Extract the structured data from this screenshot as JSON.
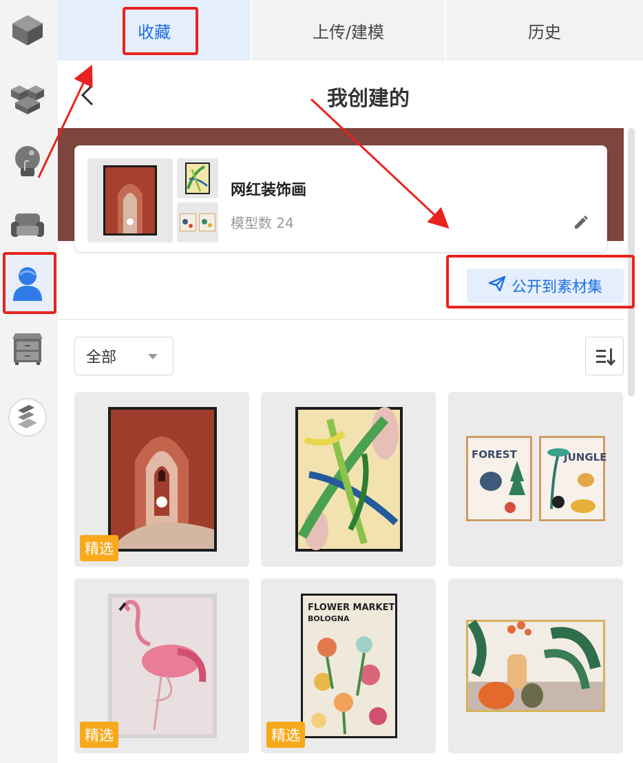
{
  "tabs": {
    "favorites_label": "收藏",
    "upload_label": "上传/建模",
    "history_label": "历史"
  },
  "header": {
    "title": "我创建的"
  },
  "collection": {
    "name": "网红装饰画",
    "model_count_text": "模型数 24"
  },
  "actions": {
    "publish_label": "公开到素材集"
  },
  "filter": {
    "selected": "全部"
  },
  "grid": {
    "badge_label": "精选",
    "items": [
      {
        "featured": true,
        "art": "terracotta-arch-painting"
      },
      {
        "featured": false,
        "art": "tropical-leaves-painting"
      },
      {
        "featured": false,
        "art": "forest-jungle-animal-prints",
        "text_forest": "FOREST",
        "text_jungle": "JUNGLE"
      },
      {
        "featured": true,
        "art": "pink-flamingo-print"
      },
      {
        "featured": true,
        "art": "flower-market-poster",
        "text_line1": "FLOWER MARKET",
        "text_line2": "BOLOGNA"
      },
      {
        "featured": false,
        "art": "still-life-vases-painting"
      }
    ]
  },
  "colors": {
    "accent_blue": "#1d6fe0",
    "banner_brown": "#7d453d",
    "badge_orange": "#f7a81b",
    "annotation_red": "#e8231f"
  },
  "icons": {
    "rail": [
      "cube-icon",
      "stacked-blocks-icon",
      "lightbulb-icon",
      "sofa-icon",
      "user-icon",
      "cabinet-icon",
      "layers-logo-icon"
    ],
    "back": "chevron-left-icon",
    "edit": "pencil-icon",
    "publish": "paper-plane-icon",
    "sort": "sort-icon",
    "filter_caret": "caret-down-icon"
  }
}
